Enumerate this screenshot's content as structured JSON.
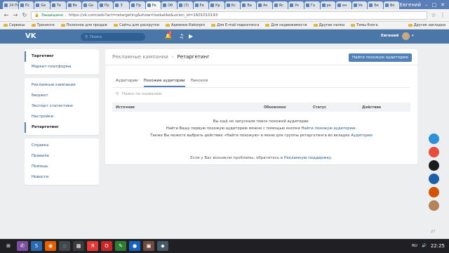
{
  "browser": {
    "tabs": [
      {
        "label": "24 По"
      },
      {
        "label": "Пс"
      },
      {
        "label": "Ge"
      },
      {
        "label": "Тв"
      },
      {
        "label": "Ве"
      },
      {
        "label": "Ge"
      },
      {
        "label": "Пр"
      },
      {
        "label": "З"
      },
      {
        "label": "Пр"
      },
      {
        "label": "Ре",
        "active": true
      },
      {
        "label": "Об"
      },
      {
        "label": "(3)"
      },
      {
        "label": "Ра"
      },
      {
        "label": "Кр"
      },
      {
        "label": "Кс"
      },
      {
        "label": "Ва"
      },
      {
        "label": "Ак"
      },
      {
        "label": "Яс"
      },
      {
        "label": "Ук"
      },
      {
        "label": "Га"
      },
      {
        "label": "ре"
      },
      {
        "label": "ен"
      },
      {
        "label": "Ув"
      },
      {
        "label": "Бе"
      },
      {
        "label": "Во"
      }
    ],
    "window_user": "Евгений",
    "secure_label": "Защищено",
    "url": "https://vk.com/ads?act=retargeting&show=lookalike&union_id=1601010193",
    "bookmarks": [
      "Сервисы",
      "Тренинги",
      "Полезное для продаж",
      "Сайты для раскрутки",
      "Админки Rietorpro",
      "Для E-mail маркетинга",
      "Для недвижимости",
      "Другие папки",
      "Темы блога"
    ],
    "bookmarks_other": "Другие закладки"
  },
  "vk": {
    "logo": "VK",
    "search_placeholder": "Поиск",
    "notifications_badge": "3",
    "user_name": "Евгений"
  },
  "sidebar": {
    "group1": [
      {
        "label": "Таргетинг",
        "active": true
      },
      {
        "label": "Маркет-платформа"
      }
    ],
    "group2": [
      {
        "label": "Рекламные кампании"
      },
      {
        "label": "Бюджет"
      },
      {
        "label": "Экспорт статистики"
      },
      {
        "label": "Настройки"
      },
      {
        "label": "Ретаргетинг",
        "active": true
      }
    ],
    "group3": [
      {
        "label": "Справка"
      },
      {
        "label": "Правила"
      },
      {
        "label": "Помощь"
      },
      {
        "label": "Новости"
      }
    ]
  },
  "main": {
    "breadcrumb_parent": "Рекламные кампании",
    "breadcrumb_current": "Ретаргетинг",
    "find_button": "Найти похожую аудиторию",
    "tabs": [
      "Аудитории",
      "Похожие аудитории",
      "Пиксели"
    ],
    "filter_placeholder": "Поиск по названию",
    "columns": [
      "Источник",
      "Обновлено",
      "Статус",
      "Действие"
    ],
    "empty_line1": "Вы ещё не запускали поиск похожей аудитории.",
    "empty_line2_prefix": "Найти Вашу первую похожую аудиторию можно с помощью кнопки ",
    "empty_line2_link": "Найти похожую аудиторию",
    "empty_line3_prefix": "Также Вы можете выбрать действие «Найти похожую» в меню для группы ретаргетинга во вкладке ",
    "empty_line3_link": "Аудитории"
  },
  "footer": {
    "prefix": "Если у Вас возникли проблемы, обратитесь в ",
    "link": "Рекламную поддержку"
  },
  "widget_count": "27",
  "taskbar": {
    "lang": "RU",
    "time": "22:25"
  },
  "colors": {
    "vk_blue": "#4a76a8",
    "accent": "#5181b8",
    "link": "#2a5885"
  }
}
